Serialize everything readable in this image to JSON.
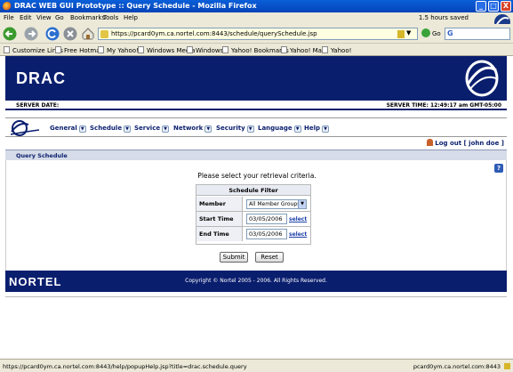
{
  "window": {
    "title": "DRAC WEB GUI Prototype :: Query Schedule - Mozilla Firefox",
    "min_label": "_",
    "max_label": "□",
    "close_label": "X"
  },
  "menubar": {
    "items": [
      "File",
      "Edit",
      "View",
      "Go",
      "Bookmarks",
      "Tools",
      "Help"
    ],
    "saved_status": "1.5 hours saved"
  },
  "navbar": {
    "url": "https://pcard0ym.ca.nortel.com:8443/schedule/querySchedule.jsp",
    "go_label": "Go",
    "search_engine": "G"
  },
  "bookmarks": {
    "items": [
      "Customize Links",
      "Free Hotmail",
      "My Yahoo!",
      "Windows Media",
      "Windows",
      "Yahoo! Bookmarks",
      "Yahoo! Mail",
      "Yahoo!"
    ]
  },
  "app": {
    "logo_text": "DRAC",
    "server_date_label": "SERVER DATE:",
    "server_time": "SERVER TIME: 12:49:17 am GMT-05:00",
    "nav": [
      "General",
      "Schedule",
      "Service",
      "Network",
      "Security",
      "Language",
      "Help"
    ],
    "logout": "Log out [ john doe ]",
    "section_title": "Query Schedule",
    "help_label": "?",
    "prompt": "Please select your retrieval criteria.",
    "filter": {
      "title": "Schedule Filter",
      "member_group_label": "Member Group",
      "member_group_value": "All Member Groups",
      "start_label": "Start Time",
      "start_value": "03/05/2006",
      "end_label": "End Time",
      "end_value": "03/05/2006",
      "select_link": "select"
    },
    "submit_label": "Submit",
    "reset_label": "Reset",
    "footer_logo": "NORTEL",
    "copyright": "Copyright © Nortel 2005 - 2006. All Rights Reserved."
  },
  "statusbar": {
    "link": "https://pcard0ym.ca.nortel.com:8443/help/popupHelp.jsp?title=drac.schedule.query",
    "host": "pcard0ym.ca.nortel.com:8443"
  },
  "colors": {
    "brand_navy": "#0a1e6e",
    "titlebar_blue": "#0543b8",
    "chrome": "#ece9d8"
  }
}
